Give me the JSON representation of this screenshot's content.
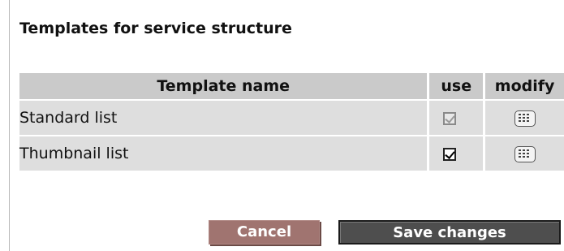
{
  "panel": {
    "title": "Templates for service structure"
  },
  "table": {
    "headers": {
      "name": "Template name",
      "use": "use",
      "modify": "modify"
    },
    "rows": [
      {
        "name": "Standard list",
        "use_checked": true,
        "use_disabled": true,
        "modify_icon": "edit-list-icon"
      },
      {
        "name": "Thumbnail list",
        "use_checked": true,
        "use_disabled": false,
        "modify_icon": "edit-list-icon"
      }
    ]
  },
  "actions": {
    "cancel_label": "Cancel",
    "save_label": "Save changes"
  },
  "colors": {
    "header_bg": "#cacaca",
    "row_bg": "#dedede",
    "cancel_bg": "#a07470",
    "save_bg": "#4e4e4e"
  }
}
